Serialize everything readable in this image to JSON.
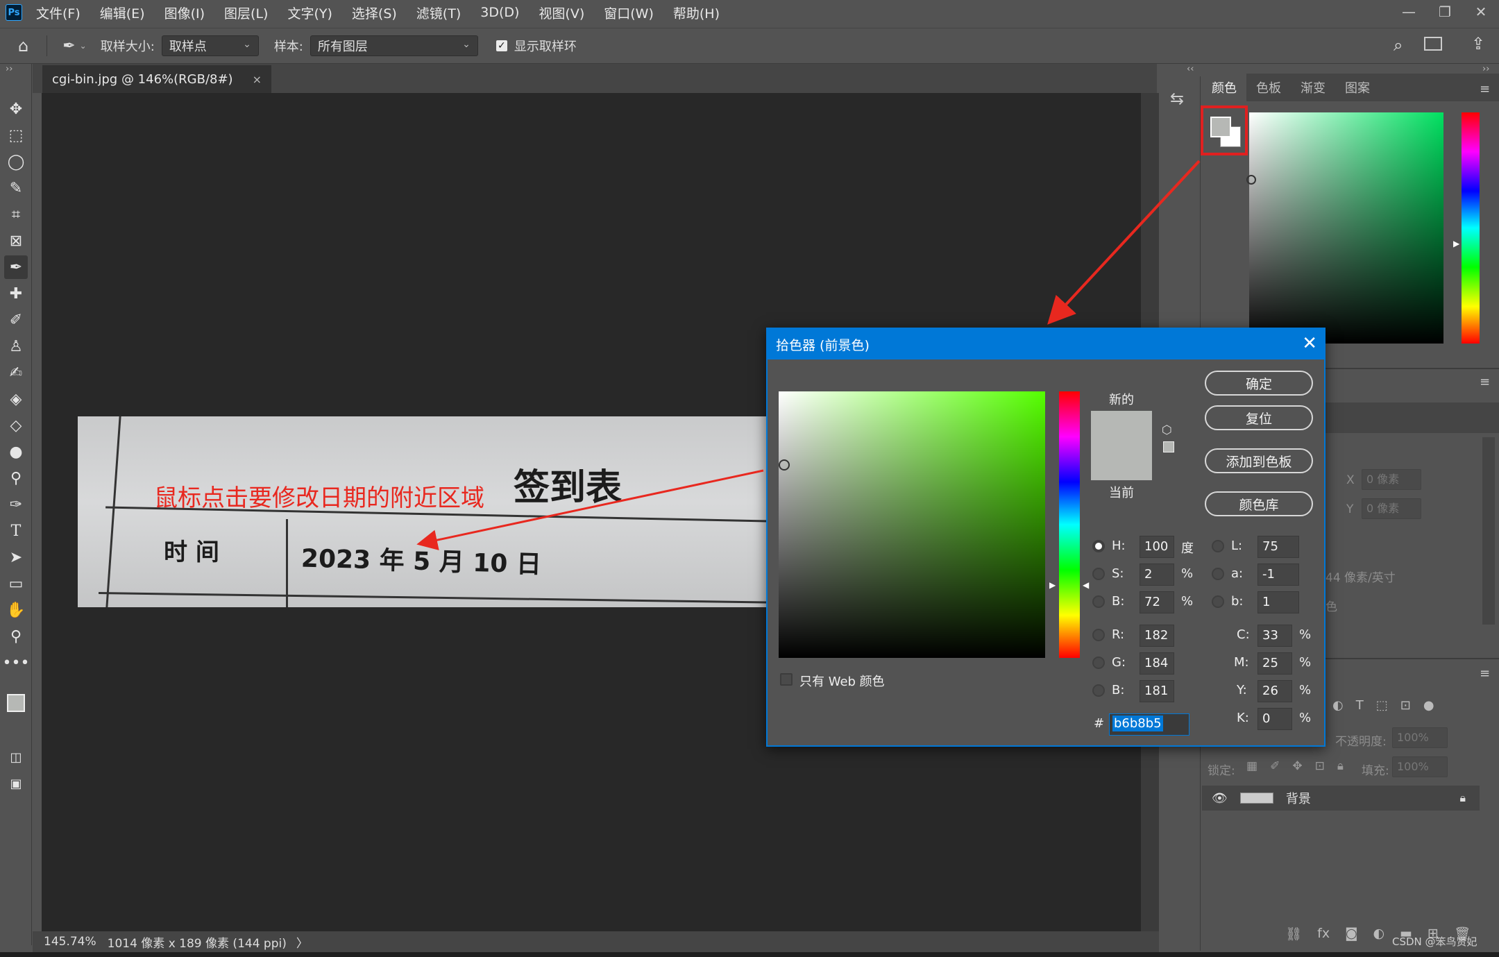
{
  "menubar": {
    "logo": "Ps",
    "items": [
      "文件(F)",
      "编辑(E)",
      "图像(I)",
      "图层(L)",
      "文字(Y)",
      "选择(S)",
      "滤镜(T)",
      "3D(D)",
      "视图(V)",
      "窗口(W)",
      "帮助(H)"
    ],
    "window_controls": [
      "minimize-icon",
      "restore-icon",
      "close-icon"
    ]
  },
  "options": {
    "sample_size_label": "取样大小:",
    "sample_size_value": "取样点",
    "sample_label": "样本:",
    "sample_value": "所有图层",
    "show_ring_label": "显示取样环",
    "show_ring_checked": true
  },
  "document": {
    "tab_title": "cgi-bin.jpg @ 146%(RGB/8#)",
    "close_glyph": "×"
  },
  "image_text": {
    "sign_title": "签到表",
    "time_label": "时 间",
    "date_text": "2023 年 5 月 10 日"
  },
  "annotation": {
    "text": "鼠标点击要修改日期的附近区域",
    "color": "#e8281f"
  },
  "status": {
    "zoom": "145.74%",
    "doc_info": "1014 像素 x 189 像素 (144 ppi)",
    "arrow": "〉"
  },
  "color_panel": {
    "tabs": [
      "颜色",
      "色板",
      "渐变",
      "图案"
    ],
    "active_tab": "颜色",
    "foreground_color": "#b6b8b5",
    "background_color": "#ffffff"
  },
  "properties_panel": {
    "x_label": "X",
    "x_value": "0 像素",
    "y_label": "Y",
    "y_value": "0 像素",
    "resolution": "44 像素/英寸",
    "mode_fragment": "色"
  },
  "layers_panel": {
    "opacity_label": "不透明度:",
    "opacity_value": "100%",
    "lock_label": "锁定:",
    "fill_label": "填充:",
    "fill_value": "100%",
    "layer_name": "背景"
  },
  "dialog": {
    "title": "拾色器 (前景色)",
    "new_label": "新的",
    "current_label": "当前",
    "buttons": {
      "ok": "确定",
      "reset": "复位",
      "add_swatch": "添加到色板",
      "libraries": "颜色库"
    },
    "web_only_label": "只有 Web 颜色",
    "fields": {
      "H": {
        "label": "H:",
        "value": "100",
        "unit": "度"
      },
      "S": {
        "label": "S:",
        "value": "2",
        "unit": "%"
      },
      "B": {
        "label": "B:",
        "value": "72",
        "unit": "%"
      },
      "R": {
        "label": "R:",
        "value": "182"
      },
      "G": {
        "label": "G:",
        "value": "184"
      },
      "Bl": {
        "label": "B:",
        "value": "181"
      },
      "L": {
        "label": "L:",
        "value": "75"
      },
      "a": {
        "label": "a:",
        "value": "-1"
      },
      "b": {
        "label": "b:",
        "value": "1"
      },
      "C": {
        "label": "C:",
        "value": "33",
        "unit": "%"
      },
      "M": {
        "label": "M:",
        "value": "25",
        "unit": "%"
      },
      "Y": {
        "label": "Y:",
        "value": "26",
        "unit": "%"
      },
      "K": {
        "label": "K:",
        "value": "0",
        "unit": "%"
      }
    },
    "hex_label": "#",
    "hex_value": "b6b8b5",
    "new_color": "#b6b8b5"
  },
  "watermark": "CSDN @笨鸟贤妃"
}
